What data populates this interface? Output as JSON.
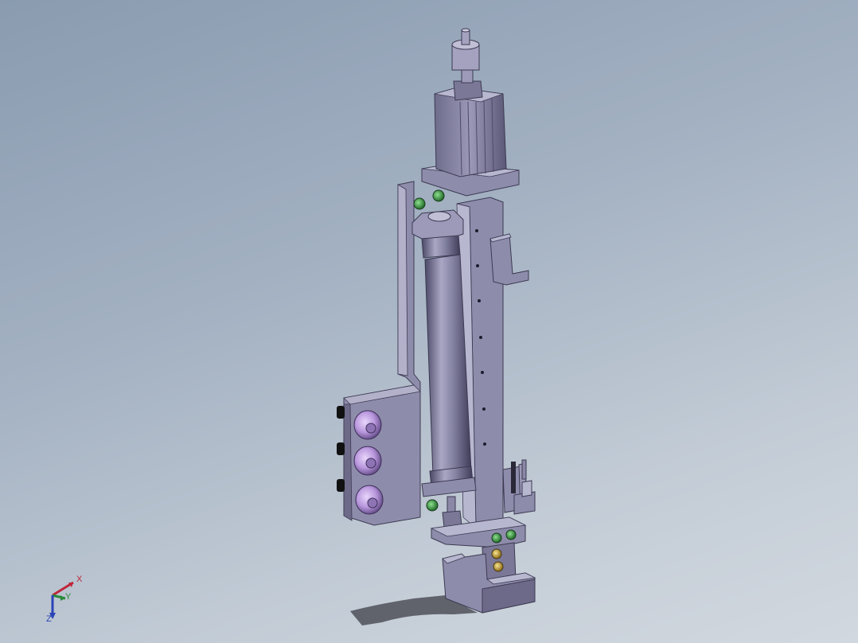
{
  "viewport": {
    "background_top": "#8a9bb0",
    "background_bottom": "#d2d8df",
    "model": {
      "part_color": "#8e8cab",
      "part_shadow_color": "#5d5b78",
      "part_highlight_color": "#b8b7d0",
      "screw_color": "#3aa04a",
      "brass_color": "#c9a43a",
      "knob_color": "#c8a8e8"
    },
    "triad": {
      "x_label": "X",
      "y_label": "Y",
      "z_label": "Z",
      "x_color": "#c0263a",
      "y_color": "#2a8a3a",
      "z_color": "#2a44b8"
    }
  }
}
